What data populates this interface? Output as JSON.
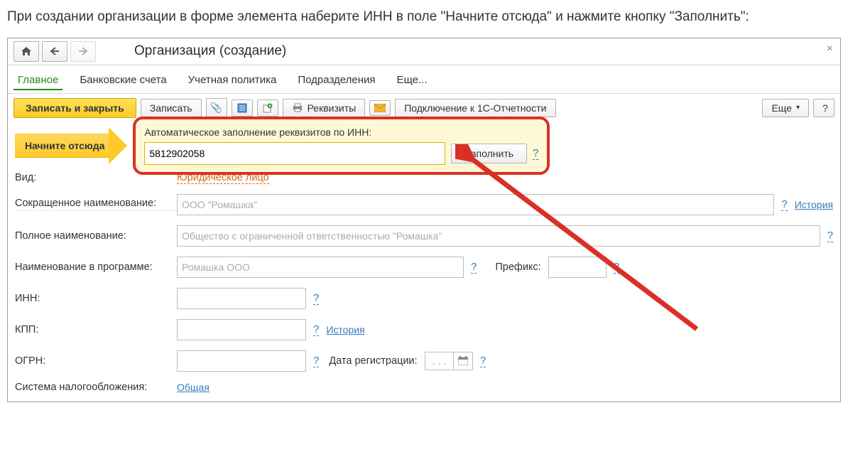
{
  "intro": "При создании организации в форме элемента наберите ИНН в поле \"Начните отсюда\" и нажмите кнопку \"Заполнить\":",
  "window": {
    "title": "Организация (создание)",
    "tabs": {
      "main": "Главное",
      "bank": "Банковские счета",
      "policy": "Учетная политика",
      "dept": "Подразделения",
      "more": "Еще..."
    },
    "toolbar": {
      "save_close": "Записать и закрыть",
      "save": "Записать",
      "requisites": "Реквизиты",
      "connect": "Подключение к 1С-Отчетности",
      "more": "Еще",
      "help": "?"
    },
    "start_here": "Начните отсюда",
    "autofill": {
      "label": "Автоматическое заполнение реквизитов по ИНН:",
      "value": "5812902058",
      "fill": "Заполнить",
      "help": "?"
    },
    "fields": {
      "kind": {
        "label": "Вид:",
        "value": "Юридическое лицо"
      },
      "short": {
        "label": "Сокращенное наименование:",
        "placeholder": "ООО \"Ромашка\"",
        "help": "?",
        "history": "История"
      },
      "full": {
        "label": "Полное наименование:",
        "placeholder": "Общество с ограниченной ответственностью \"Ромашка\"",
        "help": "?"
      },
      "prog": {
        "label": "Наименование в программе:",
        "placeholder": "Ромашка ООО",
        "help": "?",
        "prefix_label": "Префикс:",
        "prefix_help": "?"
      },
      "inn": {
        "label": "ИНН:",
        "help": "?"
      },
      "kpp": {
        "label": "КПП:",
        "help": "?",
        "history": "История"
      },
      "ogrn": {
        "label": "ОГРН:",
        "help": "?",
        "regdate_label": "Дата регистрации:",
        "regdate_value": ". . .",
        "regdate_help": "?"
      },
      "tax": {
        "label": "Система налогообложения:",
        "value": "Общая"
      }
    }
  }
}
